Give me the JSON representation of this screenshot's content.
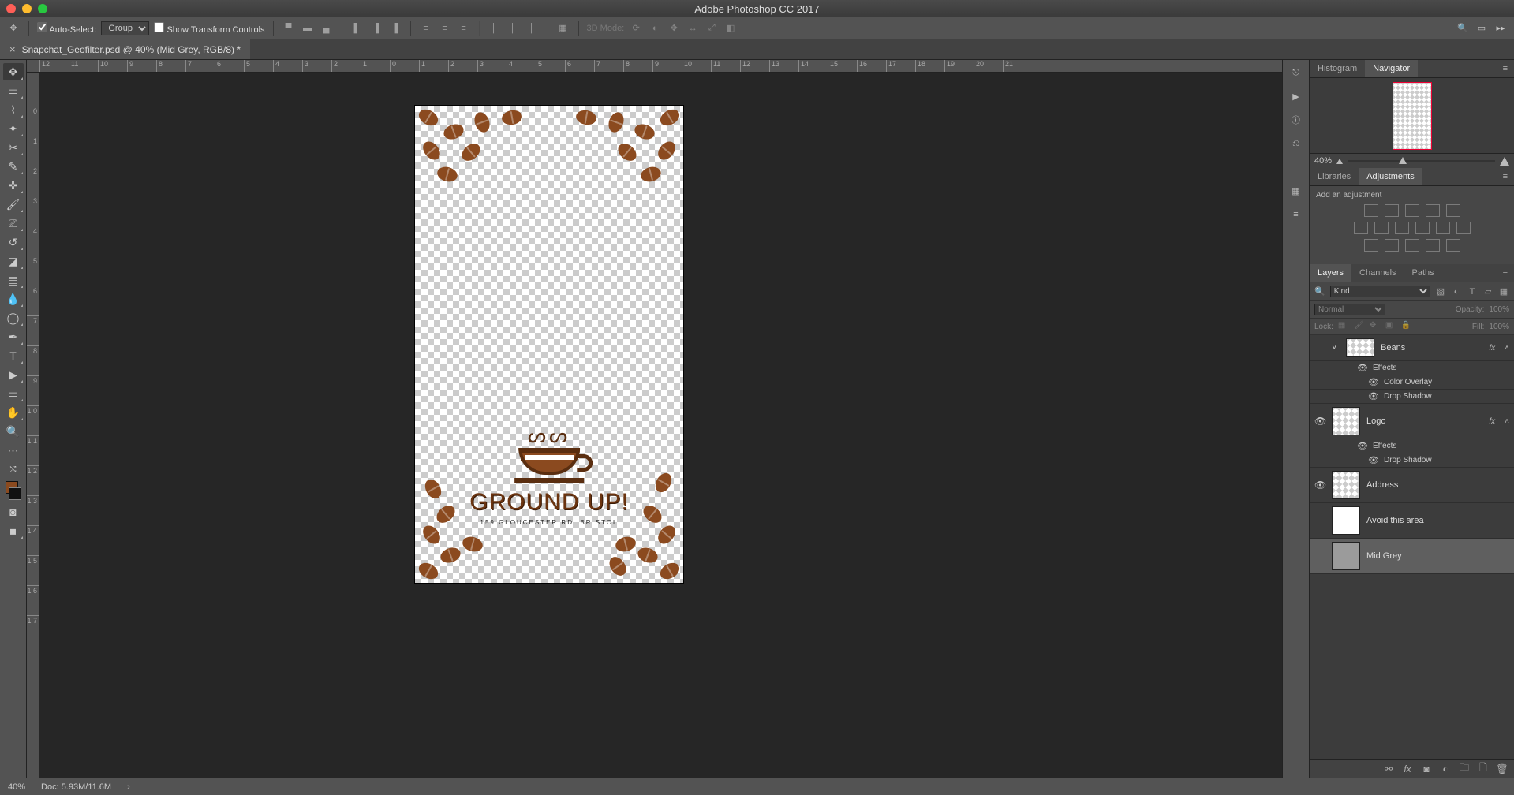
{
  "app": {
    "title": "Adobe Photoshop CC 2017"
  },
  "options": {
    "autoSelectLabel": "Auto-Select:",
    "autoSelectChecked": true,
    "autoSelectMode": "Group",
    "showTransformLabel": "Show Transform Controls",
    "showTransformChecked": false,
    "modeLabel": "3D Mode:"
  },
  "doc": {
    "tabTitle": "Snapchat_Geofilter.psd @ 40% (Mid Grey, RGB/8) *"
  },
  "ruler": {
    "h": [
      "12",
      "11",
      "10",
      "9",
      "8",
      "7",
      "6",
      "5",
      "4",
      "3",
      "2",
      "1",
      "0",
      "1",
      "2",
      "3",
      "4",
      "5",
      "6",
      "7",
      "8",
      "9",
      "10",
      "11",
      "12",
      "13",
      "14",
      "15",
      "16",
      "17",
      "18",
      "19",
      "20",
      "21"
    ],
    "v": [
      "0",
      "1",
      "2",
      "3",
      "4",
      "5",
      "6",
      "7",
      "8",
      "9",
      "1 0",
      "1 1",
      "1 2",
      "1 3",
      "1 4",
      "1 5",
      "1 6",
      "1 7"
    ]
  },
  "art": {
    "brand": "GROUND UP!",
    "address": "159 GLOUCESTER RD. BRISTOL"
  },
  "nav": {
    "tabHistogram": "Histogram",
    "tabNavigator": "Navigator",
    "zoom": "40%"
  },
  "libs": {
    "tabLibraries": "Libraries",
    "tabAdjustments": "Adjustments",
    "addLabel": "Add an adjustment"
  },
  "layersPanel": {
    "tabLayers": "Layers",
    "tabChannels": "Channels",
    "tabPaths": "Paths",
    "kindLabel": "Kind",
    "blendMode": "Normal",
    "opacityLabel": "Opacity:",
    "opacityVal": "100%",
    "lockLabel": "Lock:",
    "fillLabel": "Fill:",
    "fillVal": "100%"
  },
  "layers": [
    {
      "name": "Beans",
      "vis": false,
      "fx": true,
      "type": "checker",
      "effects": [
        "Color Overlay",
        "Drop Shadow"
      ],
      "collapsed": false,
      "partial": true
    },
    {
      "name": "Logo",
      "vis": true,
      "fx": true,
      "type": "checker",
      "effects": [
        "Drop Shadow"
      ]
    },
    {
      "name": "Address",
      "vis": true,
      "fx": false,
      "type": "checker"
    },
    {
      "name": "Avoid this area",
      "vis": false,
      "fx": false,
      "type": "white"
    },
    {
      "name": "Mid Grey",
      "vis": false,
      "fx": false,
      "type": "grey",
      "selected": true
    }
  ],
  "fxLabel": "Effects",
  "status": {
    "zoom": "40%",
    "doc": "Doc: 5.93M/11.6M"
  }
}
